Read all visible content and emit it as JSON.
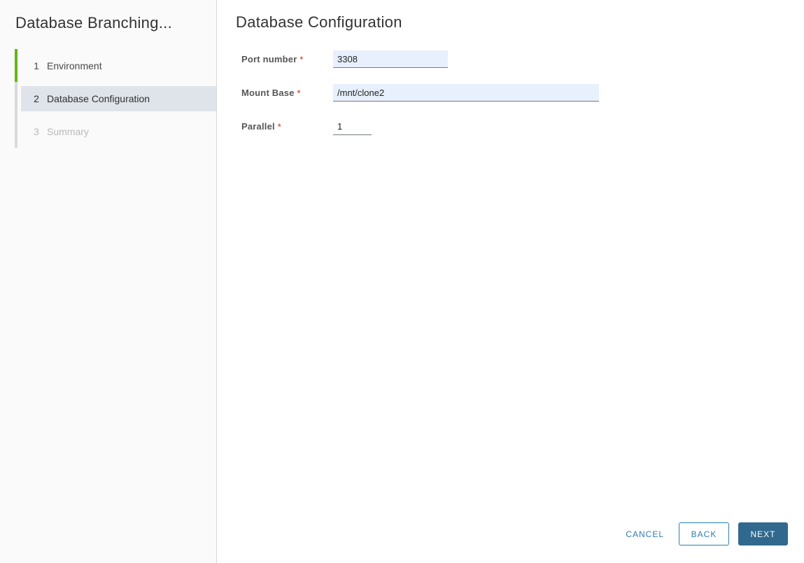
{
  "wizard": {
    "sidebar": {
      "title": "Database Branching...",
      "steps": [
        {
          "number": "1",
          "label": "Environment",
          "state": "completed"
        },
        {
          "number": "2",
          "label": "Database Configuration",
          "state": "current"
        },
        {
          "number": "3",
          "label": "Summary",
          "state": "disabled"
        }
      ]
    },
    "main": {
      "title": "Database Configuration",
      "fields": [
        {
          "label": "Port number",
          "required_mark": "*",
          "value": "3308"
        },
        {
          "label": "Mount Base",
          "required_mark": "*",
          "value": "/mnt/clone2"
        },
        {
          "label": "Parallel",
          "required_mark": "*",
          "value": "1"
        }
      ]
    },
    "footer": {
      "cancel_label": "CANCEL",
      "back_label": "BACK",
      "next_label": "NEXT"
    },
    "colors": {
      "accent_blue": "#2d7db3",
      "primary_button_bg": "#31698e",
      "step_completed_green": "#61b715",
      "current_step_bg": "#dee4ea",
      "input_filled_bg": "#e8f0fe",
      "required_mark_red": "#d4604f",
      "sidebar_bg": "#fafafa"
    }
  }
}
